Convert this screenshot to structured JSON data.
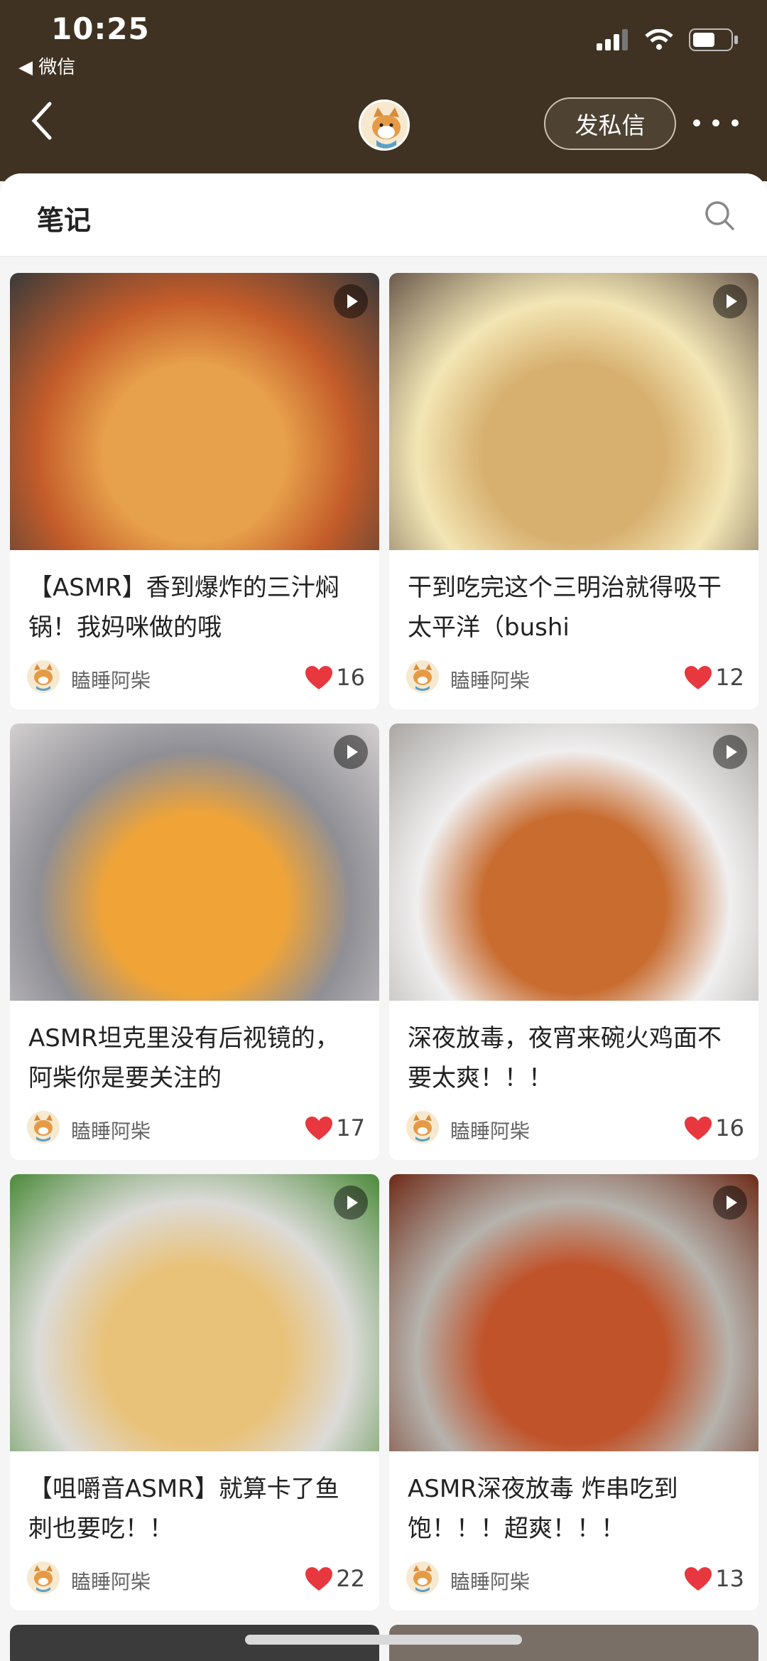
{
  "status": {
    "time": "10:25",
    "back_app": "◀ 微信"
  },
  "header": {
    "message_button": "发私信"
  },
  "sheet": {
    "title": "笔记"
  },
  "notes": [
    {
      "title": "【ASMR】香到爆炸的三汁焖锅！我妈咪做的哦",
      "author": "瞌睡阿柴",
      "likes": "16",
      "palette": [
        "#c45c2a",
        "#e7a04b",
        "#3a3a3a"
      ]
    },
    {
      "title": "干到吃完这个三明治就得吸干太平洋（bushi",
      "author": "瞌睡阿柴",
      "likes": "12",
      "palette": [
        "#f3e6b5",
        "#d7b070",
        "#6b5a4c"
      ]
    },
    {
      "title": "ASMR坦克里没有后视镜的，阿柴你是要关注的",
      "author": "瞌睡阿柴",
      "likes": "17",
      "palette": [
        "#8f8f95",
        "#f0a437",
        "#d3cfcf"
      ]
    },
    {
      "title": "深夜放毒，夜宵来碗火鸡面不要太爽！！！",
      "author": "瞌睡阿柴",
      "likes": "16",
      "palette": [
        "#f0efef",
        "#c86c30",
        "#a9a6a3"
      ]
    },
    {
      "title": "【咀嚼音ASMR】就算卡了鱼刺也要吃！！",
      "author": "瞌睡阿柴",
      "likes": "22",
      "palette": [
        "#dcdbd8",
        "#e9c27a",
        "#4b8a3a"
      ]
    },
    {
      "title": "ASMR深夜放毒 炸串吃到饱！！！超爽！！！",
      "author": "瞌睡阿柴",
      "likes": "13",
      "palette": [
        "#b6b3ad",
        "#c0532a",
        "#6e2b18"
      ]
    }
  ]
}
